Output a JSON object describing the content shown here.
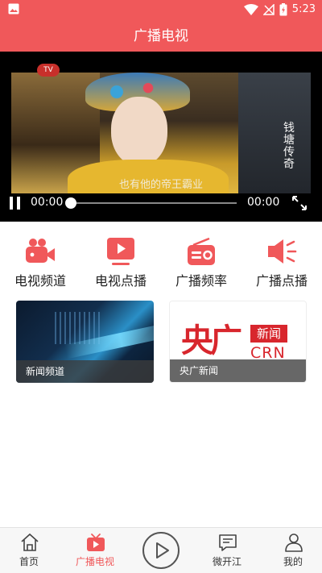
{
  "status_bar": {
    "time": "5:23",
    "icons": [
      "image-icon",
      "wifi-icon",
      "no-signal-icon",
      "battery-charging-icon"
    ]
  },
  "header": {
    "title": "广播电视"
  },
  "player": {
    "current_time": "00:00",
    "duration": "00:00",
    "progress": 0,
    "subtitle": "也有他的帝王霸业",
    "watermark_text": "钱塘传奇",
    "channel_logo_text": "TV"
  },
  "quick_actions": [
    {
      "label": "电视频道",
      "icon": "video-camera-icon"
    },
    {
      "label": "电视点播",
      "icon": "play-screen-icon"
    },
    {
      "label": "广播频率",
      "icon": "radio-icon"
    },
    {
      "label": "广播点播",
      "icon": "speaker-icon"
    }
  ],
  "cards": [
    {
      "caption": "新闻频道"
    },
    {
      "caption": "央广新闻",
      "logo_main": "央广",
      "logo_tag": "新闻",
      "logo_en": "CRN"
    }
  ],
  "bottom_nav": {
    "items": [
      {
        "label": "首页",
        "icon": "home-icon",
        "active": false
      },
      {
        "label": "广播电视",
        "icon": "tv-icon",
        "active": true
      },
      {
        "label": "",
        "icon": "play-circle-icon",
        "active": false
      },
      {
        "label": "微开江",
        "icon": "chat-bubble-icon",
        "active": false
      },
      {
        "label": "我的",
        "icon": "user-icon",
        "active": false
      }
    ]
  },
  "colors": {
    "accent": "#f0585a",
    "logo_red": "#d8262d"
  }
}
